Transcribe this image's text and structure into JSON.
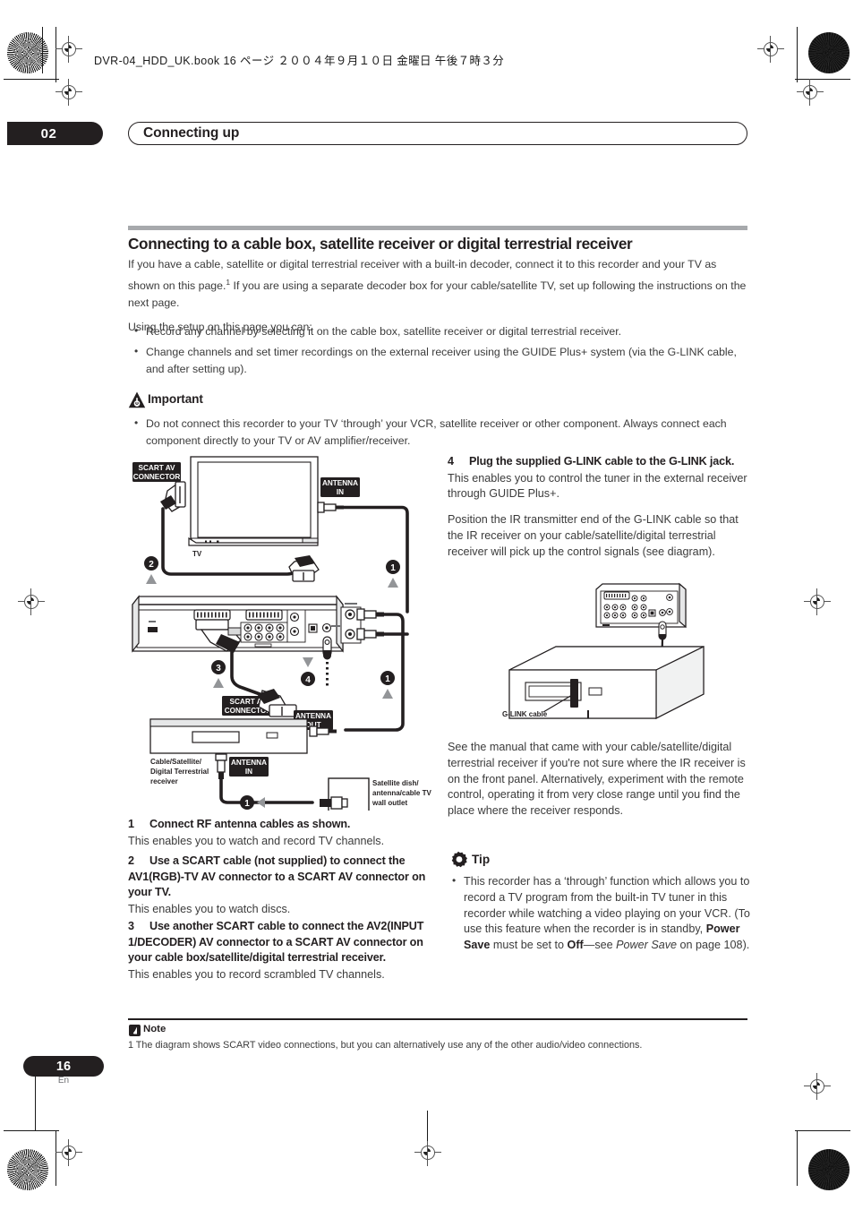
{
  "print_header": {
    "file_info": "DVR-04_HDD_UK.book   16 ページ   ２００４年９月１０日   金曜日   午後７時３分"
  },
  "chapter": {
    "number": "02",
    "title": "Connecting up"
  },
  "section": {
    "heading": "Connecting to a cable box, satellite receiver or digital terrestrial receiver",
    "intro_para_1": "If you have a cable, satellite or digital terrestrial receiver with a built-in decoder, connect it to this recorder and your TV as shown on this page.",
    "intro_footnote_marker": "1",
    "intro_para_1b": " If you are using a separate decoder box for your cable/satellite TV, set up following the instructions on the next page.",
    "intro_para_2": "Using the setup on this page you can:",
    "bullets": [
      "Record any channel by selecting it on the cable box, satellite receiver or digital terrestrial receiver.",
      "Change channels and set timer recordings on the external receiver using the GUIDE Plus+ system (via the G-LINK cable, and after setting up)."
    ]
  },
  "important": {
    "label": "Important",
    "icon": "warning-triangle-icon",
    "bullets": [
      "Do not connect this recorder to your TV ‘through’ your VCR, satellite receiver or other component. Always connect each component directly to your TV or AV amplifier/receiver."
    ]
  },
  "diagram_main": {
    "labels": {
      "scart_av_connector_tv": "SCART AV\nCONNECTOR",
      "scart_av_connector_tv_line1": "SCART AV",
      "scart_av_connector_tv_line2": "CONNECTOR",
      "antenna_in_tv_line1": "ANTENNA",
      "antenna_in_tv_line2": "IN",
      "tv": "TV",
      "scart_av_connector_rx_line1": "SCART AV",
      "scart_av_connector_rx_line2": "CONNECTOR",
      "antenna_out_line1": "ANTENNA",
      "antenna_out_line2": "OUT",
      "antenna_in_rx_line1": "ANTENNA",
      "antenna_in_rx_line2": "IN",
      "receiver_line1": "Cable/Satellite/",
      "receiver_line2": "Digital Terrestrial",
      "receiver_line3": "receiver",
      "wall_outlet_line1": "Satellite dish/",
      "wall_outlet_line2": "antenna/cable TV",
      "wall_outlet_line3": "wall outlet"
    },
    "callouts": [
      "1",
      "2",
      "3",
      "4",
      "1",
      "1"
    ]
  },
  "diagram_glink": {
    "label": "G-LINK cable"
  },
  "left_steps": [
    {
      "num": "1",
      "title": "Connect RF antenna cables as shown.",
      "body": "This enables you to watch and record TV channels."
    },
    {
      "num": "2",
      "title": "Use a SCART cable (not supplied) to connect the AV1(RGB)-TV AV connector to a SCART AV connector on your TV.",
      "body": "This enables you to watch discs."
    },
    {
      "num": "3",
      "title": "Use another SCART cable to connect the AV2(INPUT 1/DECODER) AV connector to a SCART AV connector on your cable box/satellite/digital terrestrial receiver.",
      "body": "This enables you to record scrambled TV channels."
    }
  ],
  "right_step": {
    "num": "4",
    "title": "Plug the supplied G-LINK cable to the G-LINK jack.",
    "body_1": "This enables you to control the tuner in the external receiver through GUIDE Plus+.",
    "body_2": "Position the IR transmitter end of the G-LINK cable so that the IR receiver on your cable/satellite/digital terrestrial receiver will pick up the control signals (see diagram).",
    "body_3": "See the manual that came with your cable/satellite/digital terrestrial receiver if you're not sure where the IR receiver is on the front panel. Alternatively, experiment with the remote control, operating it from very close range until you find the place where the receiver responds."
  },
  "tip": {
    "label": "Tip",
    "icon": "gear-icon",
    "bullet_part_1": "This recorder has a ‘through’ function which allows you to record a TV program from the built-in TV tuner in this recorder while watching a video playing on your VCR. (To use this feature when the recorder is in standby, ",
    "bold_1": "Power Save",
    "bullet_part_2": " must be set to ",
    "bold_2": "Off",
    "bullet_part_3": "—see ",
    "italic_1": "Power Save",
    "bullet_part_4": " on page 108)."
  },
  "footnote": {
    "label": "Note",
    "icon": "note-icon",
    "text": "1 The diagram shows SCART video connections, but you can alternatively use any of the other audio/video connections."
  },
  "footer": {
    "page_number": "16",
    "language": "En"
  },
  "colors": {
    "ink": "#231f20",
    "body_text": "#3b3b3b",
    "rule_grey": "#a7a9ac",
    "callout_grey": "#939598"
  }
}
